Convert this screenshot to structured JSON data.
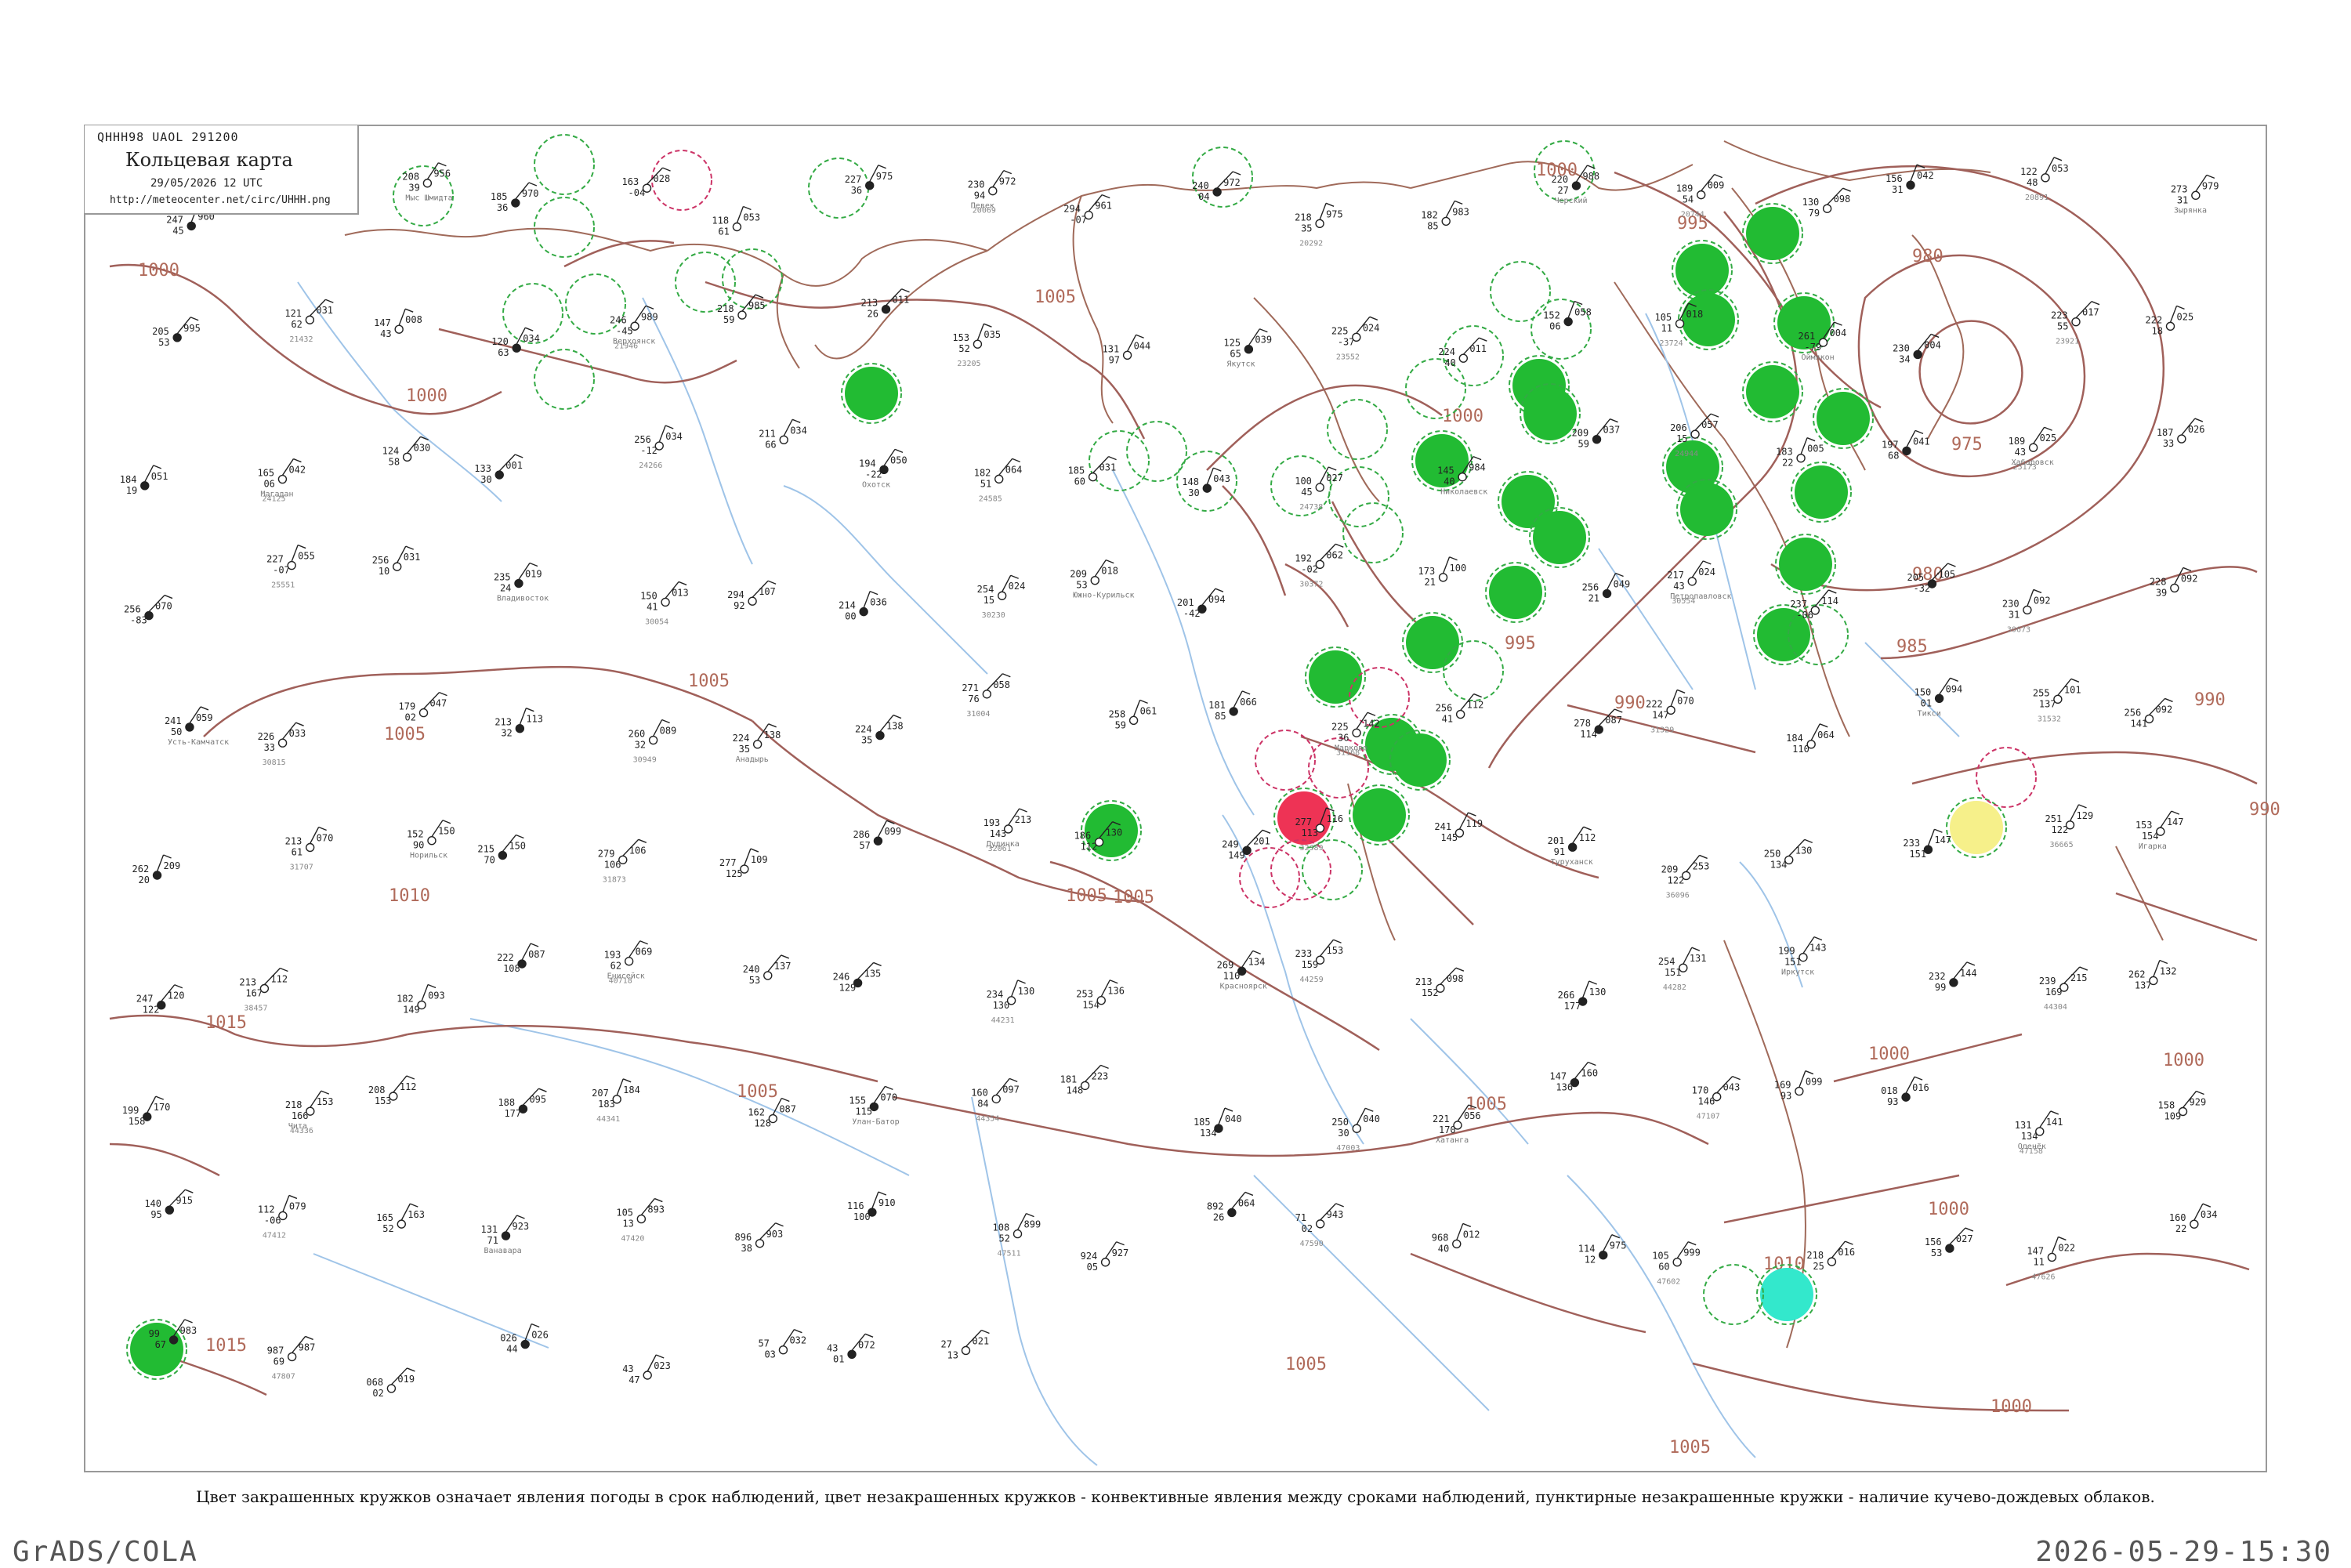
{
  "header": {
    "code": "QHHH98  UAOL  291200",
    "title": "Кольцевая карта",
    "date": "29/05/2026 12 UTC",
    "url": "http://meteocenter.net/circ/UHHH.png"
  },
  "caption": "Цвет закрашенных кружков означает явления погоды в срок наблюдений, цвет незакрашенных кружков - конвективные явления между сроками наблюдений, пунктирные незакрашенные кружки - наличие кучево-дождевых облаков.",
  "footer": {
    "left": "GrADS/COLA",
    "right": "2026-05-29-15:30"
  },
  "colors": {
    "isobar": "#a0605a",
    "river": "#9fc4e8",
    "fill_green": "#22bb33",
    "fill_red": "#ee3355",
    "fill_yellow": "#f6f08a",
    "fill_cyan": "#33e8cc",
    "dashed_green": "#33aa44",
    "dashed_red": "#cc3366",
    "frame": "#999999"
  },
  "isobar_labels": [
    "1000",
    "1000",
    "1000",
    "1000",
    "1005",
    "1005",
    "1005",
    "1005",
    "1005",
    "1005",
    "1010",
    "1010",
    "1015",
    "1015",
    "1000",
    "995",
    "980",
    "975",
    "980",
    "985",
    "990",
    "990",
    "990",
    "995",
    "1005",
    "1005",
    "1005",
    "1000",
    "1000",
    "1000"
  ],
  "stations": [
    {
      "p": "247",
      "t": "45",
      "c": "960"
    },
    {
      "p": "210",
      "t": "15",
      "c": "967"
    },
    {
      "p": "208",
      "t": "39",
      "c": "956"
    },
    {
      "p": "185",
      "t": "36",
      "c": "970"
    },
    {
      "p": "163",
      "t": "-04",
      "c": "028"
    },
    {
      "p": "118",
      "t": "61",
      "c": "053"
    },
    {
      "p": "227",
      "t": "36",
      "c": "975"
    },
    {
      "p": "230",
      "t": "94",
      "c": "972"
    },
    {
      "p": "294",
      "t": "-07",
      "c": "961"
    },
    {
      "p": "240",
      "t": "04",
      "c": "972"
    },
    {
      "p": "218",
      "t": "35",
      "c": "975"
    },
    {
      "p": "182",
      "t": "85",
      "c": "983"
    },
    {
      "p": "220",
      "t": "27",
      "c": "988"
    },
    {
      "p": "189",
      "t": "54",
      "c": "009"
    },
    {
      "p": "130",
      "t": "79",
      "c": "098"
    },
    {
      "p": "156",
      "t": "31",
      "c": "042"
    },
    {
      "p": "122",
      "t": "48",
      "c": "053"
    },
    {
      "p": "273",
      "t": "31",
      "c": "979"
    },
    {
      "p": "205",
      "t": "53",
      "c": "995"
    },
    {
      "p": "121",
      "t": "62",
      "c": "031"
    },
    {
      "p": "147",
      "t": "43",
      "c": "008"
    },
    {
      "p": "120",
      "t": "63",
      "c": "034"
    },
    {
      "p": "246",
      "t": "-45",
      "c": "989"
    },
    {
      "p": "218",
      "t": "59",
      "c": "985"
    },
    {
      "p": "213",
      "t": "26",
      "c": "011"
    },
    {
      "p": "153",
      "t": "52",
      "c": "035"
    },
    {
      "p": "131",
      "t": "97",
      "c": "044"
    },
    {
      "p": "125",
      "t": "65",
      "c": "039"
    },
    {
      "p": "225",
      "t": "-37",
      "c": "024"
    },
    {
      "p": "224",
      "t": "40",
      "c": "011"
    },
    {
      "p": "152",
      "t": "06",
      "c": "058"
    },
    {
      "p": "105",
      "t": "11",
      "c": "018"
    },
    {
      "p": "261",
      "t": "-79",
      "c": "004"
    },
    {
      "p": "230",
      "t": "34",
      "c": "004"
    },
    {
      "p": "223",
      "t": "55",
      "c": "017"
    },
    {
      "p": "222",
      "t": "18",
      "c": "025"
    },
    {
      "p": "184",
      "t": "19",
      "c": "051"
    },
    {
      "p": "165",
      "t": "06",
      "c": "042"
    },
    {
      "p": "124",
      "t": "58",
      "c": "030"
    },
    {
      "p": "133",
      "t": "30",
      "c": "001"
    },
    {
      "p": "256",
      "t": "-12",
      "c": "034"
    },
    {
      "p": "211",
      "t": "66",
      "c": "034"
    },
    {
      "p": "194",
      "t": "-22",
      "c": "050"
    },
    {
      "p": "182",
      "t": "51",
      "c": "064"
    },
    {
      "p": "185",
      "t": "60",
      "c": "031"
    },
    {
      "p": "148",
      "t": "30",
      "c": "043"
    },
    {
      "p": "100",
      "t": "45",
      "c": "027"
    },
    {
      "p": "145",
      "t": "40",
      "c": "984"
    },
    {
      "p": "209",
      "t": "59",
      "c": "037"
    },
    {
      "p": "206",
      "t": "15",
      "c": "057"
    },
    {
      "p": "183",
      "t": "22",
      "c": "005"
    },
    {
      "p": "197",
      "t": "68",
      "c": "041"
    },
    {
      "p": "189",
      "t": "43",
      "c": "025"
    },
    {
      "p": "187",
      "t": "33",
      "c": "026"
    },
    {
      "p": "256",
      "t": "-83",
      "c": "070"
    },
    {
      "p": "227",
      "t": "-07",
      "c": "055"
    },
    {
      "p": "256",
      "t": "10",
      "c": "031"
    },
    {
      "p": "235",
      "t": "24",
      "c": "019"
    },
    {
      "p": "150",
      "t": "41",
      "c": "013"
    },
    {
      "p": "294",
      "t": "92",
      "c": "107"
    },
    {
      "p": "214",
      "t": "00",
      "c": "036"
    },
    {
      "p": "254",
      "t": "15",
      "c": "024"
    },
    {
      "p": "209",
      "t": "53",
      "c": "018"
    },
    {
      "p": "201",
      "t": "-42",
      "c": "094"
    },
    {
      "p": "192",
      "t": "-02",
      "c": "062"
    },
    {
      "p": "173",
      "t": "21",
      "c": "100"
    },
    {
      "p": "256",
      "t": "21",
      "c": "049"
    },
    {
      "p": "217",
      "t": "43",
      "c": "024"
    },
    {
      "p": "237",
      "t": "-06",
      "c": "114"
    },
    {
      "p": "205",
      "t": "-32",
      "c": "105"
    },
    {
      "p": "230",
      "t": "31",
      "c": "092"
    },
    {
      "p": "228",
      "t": "39",
      "c": "092"
    },
    {
      "p": "241",
      "t": "50",
      "c": "059"
    },
    {
      "p": "226",
      "t": "33",
      "c": "033"
    },
    {
      "p": "179",
      "t": "02",
      "c": "047"
    },
    {
      "p": "213",
      "t": "32",
      "c": "113"
    },
    {
      "p": "260",
      "t": "32",
      "c": "089"
    },
    {
      "p": "224",
      "t": "35",
      "c": "138"
    },
    {
      "p": "224",
      "t": "35",
      "c": "138"
    },
    {
      "p": "271",
      "t": "76",
      "c": "058"
    },
    {
      "p": "258",
      "t": "59",
      "c": "061"
    },
    {
      "p": "181",
      "t": "85",
      "c": "066"
    },
    {
      "p": "225",
      "t": "36",
      "c": "142"
    },
    {
      "p": "256",
      "t": "41",
      "c": "112"
    },
    {
      "p": "278",
      "t": "114",
      "c": "087"
    },
    {
      "p": "222",
      "t": "147",
      "c": "070"
    },
    {
      "p": "184",
      "t": "110",
      "c": "064"
    },
    {
      "p": "150",
      "t": "01",
      "c": "094"
    },
    {
      "p": "255",
      "t": "137",
      "c": "101"
    },
    {
      "p": "256",
      "t": "141",
      "c": "092"
    },
    {
      "p": "262",
      "t": "20",
      "c": "209"
    },
    {
      "p": "213",
      "t": "61",
      "c": "070"
    },
    {
      "p": "152",
      "t": "90",
      "c": "150"
    },
    {
      "p": "215",
      "t": "70",
      "c": "150"
    },
    {
      "p": "279",
      "t": "106",
      "c": "106"
    },
    {
      "p": "277",
      "t": "125",
      "c": "109"
    },
    {
      "p": "286",
      "t": "57",
      "c": "099"
    },
    {
      "p": "193",
      "t": "143",
      "c": "213"
    },
    {
      "p": "186",
      "t": "112",
      "c": "130"
    },
    {
      "p": "249",
      "t": "149",
      "c": "201"
    },
    {
      "p": "277",
      "t": "113",
      "c": "116"
    },
    {
      "p": "241",
      "t": "145",
      "c": "119"
    },
    {
      "p": "201",
      "t": "91",
      "c": "112"
    },
    {
      "p": "209",
      "t": "122",
      "c": "253"
    },
    {
      "p": "250",
      "t": "134",
      "c": "130"
    },
    {
      "p": "233",
      "t": "151",
      "c": "147"
    },
    {
      "p": "251",
      "t": "122",
      "c": "129"
    },
    {
      "p": "153",
      "t": "154",
      "c": "147"
    },
    {
      "p": "247",
      "t": "122",
      "c": "120"
    },
    {
      "p": "213",
      "t": "167",
      "c": "112"
    },
    {
      "p": "182",
      "t": "149",
      "c": "093"
    },
    {
      "p": "222",
      "t": "108",
      "c": "087"
    },
    {
      "p": "193",
      "t": "62",
      "c": "069"
    },
    {
      "p": "240",
      "t": "53",
      "c": "137"
    },
    {
      "p": "246",
      "t": "129",
      "c": "135"
    },
    {
      "p": "234",
      "t": "130",
      "c": "130"
    },
    {
      "p": "253",
      "t": "154",
      "c": "136"
    },
    {
      "p": "269",
      "t": "110",
      "c": "134"
    },
    {
      "p": "233",
      "t": "159",
      "c": "153"
    },
    {
      "p": "213",
      "t": "152",
      "c": "098"
    },
    {
      "p": "266",
      "t": "177",
      "c": "130"
    },
    {
      "p": "254",
      "t": "151",
      "c": "131"
    },
    {
      "p": "199",
      "t": "151",
      "c": "143"
    },
    {
      "p": "232",
      "t": "99",
      "c": "144"
    },
    {
      "p": "239",
      "t": "169",
      "c": "215"
    },
    {
      "p": "262",
      "t": "137",
      "c": "132"
    },
    {
      "p": "199",
      "t": "158",
      "c": "170"
    },
    {
      "p": "218",
      "t": "166",
      "c": "153"
    },
    {
      "p": "208",
      "t": "153",
      "c": "112"
    },
    {
      "p": "188",
      "t": "177",
      "c": "095"
    },
    {
      "p": "207",
      "t": "183",
      "c": "184"
    },
    {
      "p": "162",
      "t": "128",
      "c": "087"
    },
    {
      "p": "155",
      "t": "115",
      "c": "070"
    },
    {
      "p": "160",
      "t": "84",
      "c": "097"
    },
    {
      "p": "181",
      "t": "148",
      "c": "223"
    },
    {
      "p": "185",
      "t": "134",
      "c": "040"
    },
    {
      "p": "250",
      "t": "30",
      "c": "040"
    },
    {
      "p": "221",
      "t": "170",
      "c": "056"
    },
    {
      "p": "147",
      "t": "136",
      "c": "160"
    },
    {
      "p": "170",
      "t": "146",
      "c": "043"
    },
    {
      "p": "169",
      "t": "93",
      "c": "099"
    },
    {
      "p": "018",
      "t": "93",
      "c": "016"
    },
    {
      "p": "131",
      "t": "134",
      "c": "141"
    },
    {
      "p": "158",
      "t": "109",
      "c": "929"
    },
    {
      "p": "140",
      "t": "95",
      "c": "915"
    },
    {
      "p": "112",
      "t": "-06",
      "c": "079"
    },
    {
      "p": "165",
      "t": "52",
      "c": "163"
    },
    {
      "p": "131",
      "t": "71",
      "c": "923"
    },
    {
      "p": "105",
      "t": "13",
      "c": "893"
    },
    {
      "p": "896",
      "t": "38",
      "c": "903"
    },
    {
      "p": "116",
      "t": "100",
      "c": "910"
    },
    {
      "p": "108",
      "t": "52",
      "c": "899"
    },
    {
      "p": "924",
      "t": "05",
      "c": "927"
    },
    {
      "p": "892",
      "t": "26",
      "c": "064"
    },
    {
      "p": "71",
      "t": "02",
      "c": "943"
    },
    {
      "p": "968",
      "t": "40",
      "c": "012"
    },
    {
      "p": "114",
      "t": "12",
      "c": "975"
    },
    {
      "p": "105",
      "t": "60",
      "c": "999"
    },
    {
      "p": "218",
      "t": "25",
      "c": "016"
    },
    {
      "p": "156",
      "t": "53",
      "c": "027"
    },
    {
      "p": "147",
      "t": "11",
      "c": "022"
    },
    {
      "p": "160",
      "t": "22",
      "c": "034"
    },
    {
      "p": "99",
      "t": "67",
      "c": "983"
    },
    {
      "p": "987",
      "t": "69",
      "c": "987"
    },
    {
      "p": "068",
      "t": "02",
      "c": "019"
    },
    {
      "p": "026",
      "t": "44",
      "c": "026"
    },
    {
      "p": "43",
      "t": "47",
      "c": "023"
    },
    {
      "p": "57",
      "t": "03",
      "c": "032"
    },
    {
      "p": "43",
      "t": "01",
      "c": "072"
    },
    {
      "p": "27",
      "t": "13",
      "c": "021"
    }
  ],
  "station_ids": [
    "20069",
    "20292",
    "20744",
    "20891",
    "21432",
    "21946",
    "23205",
    "23552",
    "23724",
    "23921",
    "24125",
    "24266",
    "24585",
    "24738",
    "24944",
    "25173",
    "25551",
    "30054",
    "30230",
    "30372",
    "30554",
    "30673",
    "30815",
    "30949",
    "31004",
    "31168",
    "31329",
    "31532",
    "31707",
    "31873",
    "32061",
    "32389",
    "36096",
    "36665",
    "38457",
    "40718",
    "44231",
    "44259",
    "44282",
    "44304",
    "44336",
    "44341",
    "44354",
    "47003",
    "47107",
    "47158",
    "47412",
    "47420",
    "47511",
    "47590",
    "47602",
    "47626",
    "47807"
  ],
  "place_names": [
    "Мыс Шмидта",
    "Певек",
    "Черский",
    "Зырянка",
    "Верхоянск",
    "Якутск",
    "Оймякон",
    "Магадан",
    "Охотск",
    "Николаевск",
    "Хабаровск",
    "Владивосток",
    "Южно-Курильск",
    "Петропавловск",
    "Усть-Камчатск",
    "Анадырь",
    "Марково",
    "Тикси",
    "Норильск",
    "Дудинка",
    "Туруханск",
    "Игарка",
    "Енисейск",
    "Красноярск",
    "Иркутск",
    "Чита",
    "Улан-Батор",
    "Хатанга",
    "Оленёк",
    "Ванавара"
  ]
}
